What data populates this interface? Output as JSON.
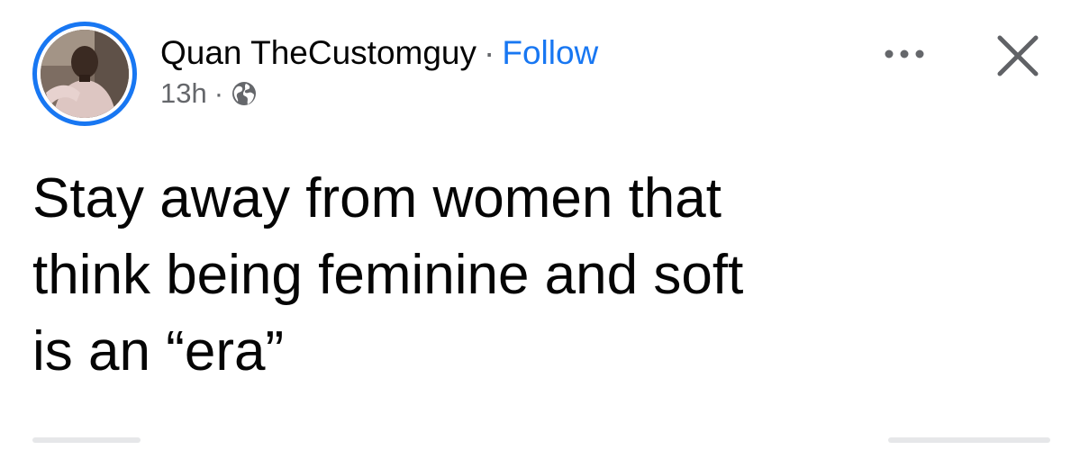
{
  "post": {
    "author": "Quan TheCustomguy",
    "separator": "·",
    "follow_label": "Follow",
    "timestamp": "13h",
    "time_separator": "·",
    "audience_icon": "globe-icon",
    "more_icon": "more-horizontal-icon",
    "close_icon": "close-icon",
    "text_lines": [
      "Stay away from women that",
      "think being feminine and soft",
      "is an “era”"
    ]
  },
  "colors": {
    "accent": "#1877f2",
    "secondary_text": "#65676b",
    "primary_text": "#050505",
    "background": "#ffffff"
  }
}
